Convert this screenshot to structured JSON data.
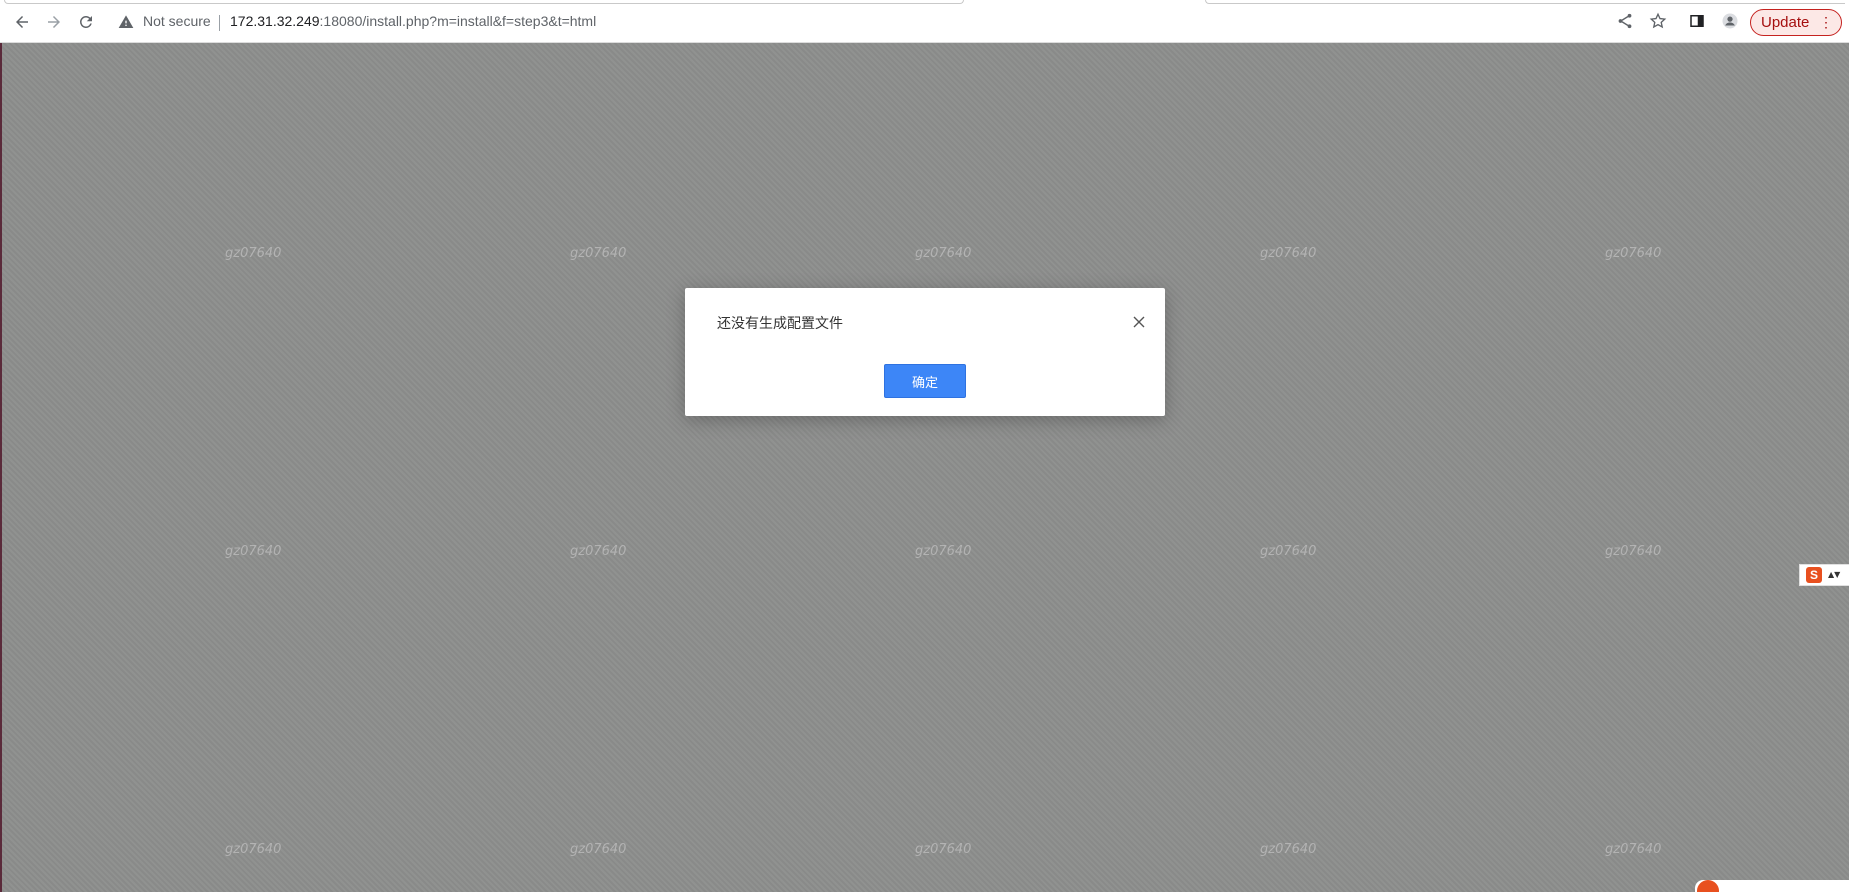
{
  "browser": {
    "security_label": "Not secure",
    "url_host": "172.31.32.249",
    "url_rest": ":18080/install.php?m=install&f=step3&t=html",
    "update_label": "Update",
    "menu_glyph": "⋮"
  },
  "icons": {
    "back": "back-arrow-icon",
    "forward": "forward-arrow-icon",
    "reload": "reload-icon",
    "warning": "warning-icon",
    "share": "share-icon",
    "bookmark": "star-icon",
    "sidepanel": "side-panel-icon",
    "profile": "profile-icon",
    "close": "close-icon"
  },
  "watermark_text": "gz07640",
  "dialog": {
    "message": "还没有生成配置文件",
    "ok_label": "确定"
  },
  "side_widget": {
    "logo_letter": "S",
    "arrows": "▲▼"
  },
  "colors": {
    "overlay": "#8d8e8d",
    "primary_button": "#3d86f7",
    "update_border": "#c5221f",
    "widget_logo": "#e8501f"
  }
}
